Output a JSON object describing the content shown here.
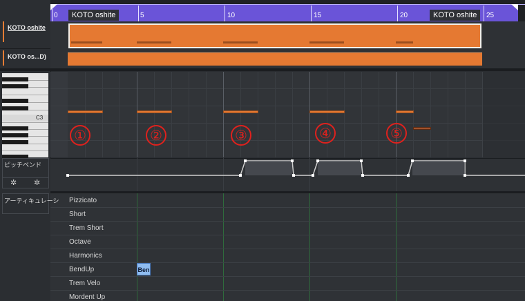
{
  "ruler": {
    "ticks": [
      "0",
      "5",
      "10",
      "15",
      "20",
      "25"
    ],
    "part_label_left": "KOTO oshite",
    "part_label_right": "KOTO oshite"
  },
  "tracks": [
    {
      "name": "KOTO oshite"
    },
    {
      "name": "KOTO os...D)"
    }
  ],
  "keyboard": {
    "c3_label": "C3"
  },
  "annotations": [
    "①",
    "②",
    "③",
    "④",
    "⑤"
  ],
  "pitchbend": {
    "label": "ピッチベンド",
    "icon_left": "snowflake-icon",
    "icon_right": "gear-icon"
  },
  "articulation": {
    "label": "アーティキュレーシ",
    "items": [
      "Pizzicato",
      "Short",
      "Trem Short",
      "Octave",
      "Harmonics",
      "BendUp",
      "Trem Velo",
      "Mordent Up"
    ],
    "selected_event_text": "Ben"
  },
  "colors": {
    "ruler_purple": "#6a54d8",
    "part_orange": "#e57932",
    "annotation_red": "#e0211d",
    "bendup_event_blue": "#8fbcf0"
  }
}
